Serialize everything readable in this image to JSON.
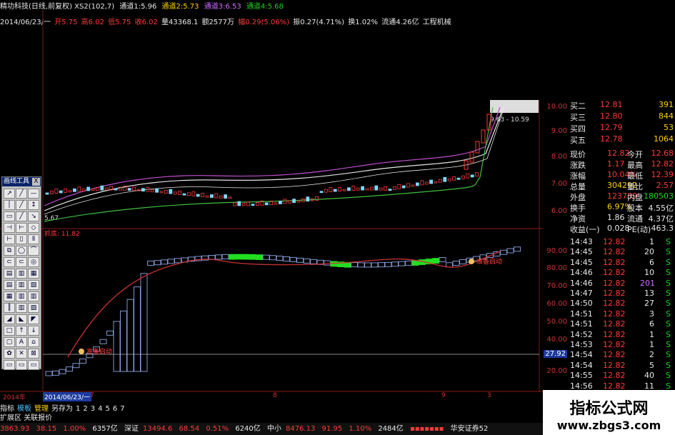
{
  "header": {
    "title": "精功科技(日线,前复权) XS2(102,7)",
    "ch1": "通道1:5.96",
    "ch2": "通道2:5.73",
    "ch3": "通道3:6.53",
    "ch4": "通道4:5.68"
  },
  "info": {
    "date": "2014/06/23/一",
    "open": "开5.75",
    "high": "高6.02",
    "low": "低5.75",
    "close": "收6.02",
    "vol": "量43368.1",
    "amt": "额2577万",
    "pct": "幅0.29(5.06%)",
    "swing": "振0.27(4.71%)",
    "turnover": "换1.02%",
    "float": "流通4.26亿",
    "sector": "工程机械"
  },
  "chart": {
    "price_range_label": "9.63 - 10.59",
    "low_label": "5.67",
    "ind_label": "抓底: 11.82",
    "tag_left": "准备启动",
    "tag_right": "准备启动",
    "axis_price": [
      "10.00",
      "9.00",
      "8.00",
      "7.00",
      "6.00"
    ],
    "axis_ind": [
      "90.00",
      "80.00",
      "70.00",
      "60.00",
      "50.00",
      "40.00",
      "30.00",
      "20.00"
    ],
    "marker_value": "27.92"
  },
  "toolbox": {
    "title": "画线工具",
    "close": "X",
    "tools": [
      "↗",
      "╱",
      "—",
      "│",
      "╱",
      "↕",
      "▭",
      "╱",
      "↘",
      "⊣",
      "⊢",
      "◇",
      "⊢",
      "▯",
      "⫴",
      "⧉",
      "◯",
      "⌒",
      "⊂",
      "⊂",
      "◎",
      "▤",
      "▥",
      "▦",
      "▤",
      "▥",
      "▨",
      "▦",
      "▥",
      "▥",
      "║",
      "▥",
      "▧",
      "◢",
      "◣",
      "◤",
      "□",
      "↑",
      "↓",
      "▢",
      "A",
      "⌂",
      "✿",
      "✕",
      "⊠",
      "▭",
      "▭",
      "▭"
    ]
  },
  "orderbook": [
    {
      "label": "买二",
      "price": "12.81",
      "vol": "391"
    },
    {
      "label": "买三",
      "price": "12.80",
      "vol": "844"
    },
    {
      "label": "买四",
      "price": "12.79",
      "vol": "53"
    },
    {
      "label": "买五",
      "price": "12.78",
      "vol": "1064"
    }
  ],
  "quote": [
    {
      "l1": "现价",
      "v1": "12.82",
      "l2": "今开",
      "v2": "12.68"
    },
    {
      "l1": "涨跌",
      "v1": "1.17",
      "l2": "最高",
      "v2": "12.82"
    },
    {
      "l1": "涨幅",
      "v1": "10.04%",
      "l2": "最低",
      "v2": "12.39"
    },
    {
      "l1": "总量",
      "v1": "304292",
      "l2": "量比",
      "v2": "2.57"
    },
    {
      "l1": "外盘",
      "v1": "123789",
      "l2": "内盘",
      "v2": "180503"
    },
    {
      "l1": "换手",
      "v1": "6.97%",
      "l2": "股本",
      "v2": "4.55亿"
    },
    {
      "l1": "净资",
      "v1": "1.86",
      "l2": "流通",
      "v2": "4.37亿"
    },
    {
      "l1": "收益(一)",
      "v1": "0.028",
      "l2": "PE(动)",
      "v2": "463.3"
    }
  ],
  "ticks": [
    {
      "t": "14:43",
      "p": "12.82",
      "v": "1",
      "s": "S"
    },
    {
      "t": "14:45",
      "p": "12.82",
      "v": "20",
      "s": "S"
    },
    {
      "t": "14:45",
      "p": "12.82",
      "v": "6",
      "s": "S"
    },
    {
      "t": "14:46",
      "p": "12.82",
      "v": "10",
      "s": "S"
    },
    {
      "t": "14:46",
      "p": "12.82",
      "v": "201",
      "s": "S"
    },
    {
      "t": "14:47",
      "p": "12.82",
      "v": "13",
      "s": "S"
    },
    {
      "t": "14:50",
      "p": "12.82",
      "v": "27",
      "s": "S"
    },
    {
      "t": "14:51",
      "p": "12.82",
      "v": "3",
      "s": "S"
    },
    {
      "t": "14:51",
      "p": "12.82",
      "v": "6",
      "s": "S"
    },
    {
      "t": "14:52",
      "p": "12.82",
      "v": "1",
      "s": "S"
    },
    {
      "t": "14:53",
      "p": "12.82",
      "v": "1",
      "s": "S"
    },
    {
      "t": "14:54",
      "p": "12.82",
      "v": "2",
      "s": "S"
    },
    {
      "t": "14:54",
      "p": "12.82",
      "v": "5",
      "s": "S"
    },
    {
      "t": "14:55",
      "p": "12.82",
      "v": "40",
      "s": "S"
    },
    {
      "t": "14:56",
      "p": "12.82",
      "v": "11",
      "s": "S"
    }
  ],
  "datebar": {
    "year": "2014年",
    "date": "2014/06/23/一",
    "m7": "7",
    "m8": "8",
    "m9": "9",
    "m3": "3"
  },
  "tabs": [
    "指标",
    "模板",
    "管理",
    "另存为",
    "1",
    "2",
    "3",
    "4",
    "5",
    "6",
    "7"
  ],
  "tabs2": [
    "扩展区",
    "关联报价"
  ],
  "status": {
    "sh": "3863.93",
    "sh_chg": "38.15",
    "sh_pct": "1.00%",
    "sh_amt": "6357亿",
    "sz_label": "深证",
    "sz": "13494.6",
    "sz_chg": "68.54",
    "sz_pct": "0.51%",
    "sz_amt": "6240亿",
    "zx_label": "中小",
    "zx": "8476.13",
    "zx_chg": "91.95",
    "zx_pct": "1.10%",
    "zx_amt": "2484亿",
    "broker": "华安证券52"
  },
  "watermark": {
    "name": "指标公式网",
    "url": "www.zbgs3.com"
  },
  "colors": {
    "up": "#ff3a3a",
    "down": "#1fd31f",
    "candle": "#7fd7ff",
    "ma_white": "#e6e6e6",
    "ma_purple": "#c04fd0",
    "ma_green": "#3fbf3f",
    "ind_red": "#c83232"
  }
}
